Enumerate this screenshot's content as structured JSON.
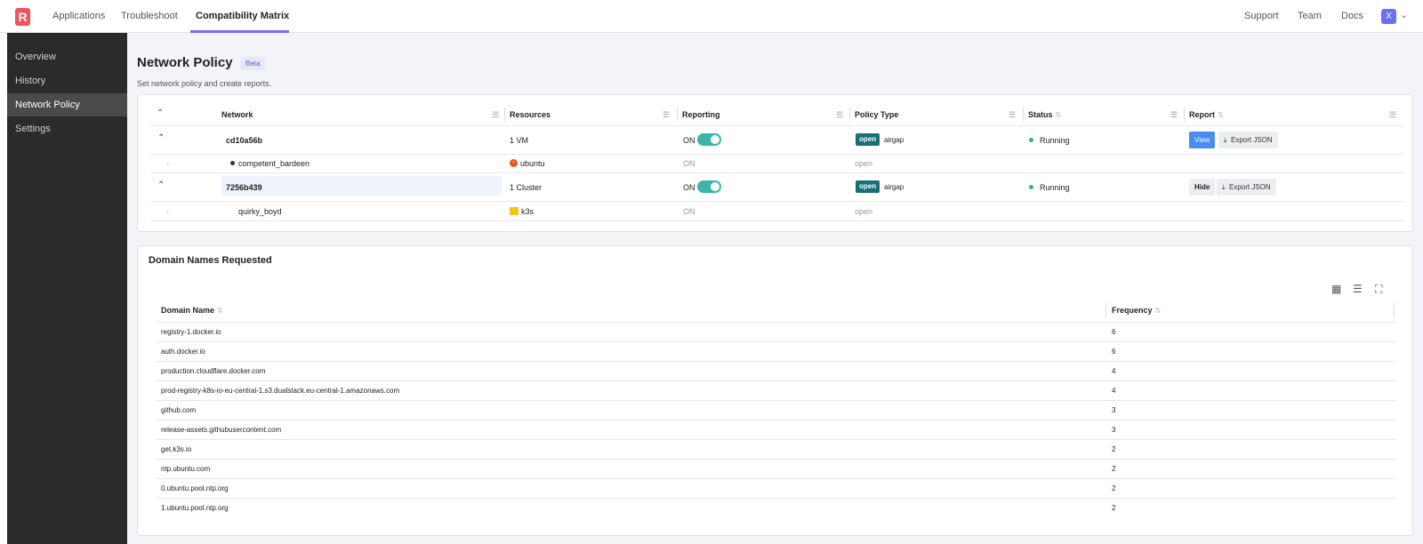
{
  "nav": {
    "logo": "R",
    "tabs": [
      {
        "label": "Applications"
      },
      {
        "label": "Troubleshoot"
      },
      {
        "label": "Compatibility Matrix"
      }
    ],
    "right": [
      {
        "label": "Support"
      },
      {
        "label": "Team"
      },
      {
        "label": "Docs"
      }
    ],
    "avatar": "X"
  },
  "sidebar": {
    "items": [
      {
        "label": "Overview"
      },
      {
        "label": "History"
      },
      {
        "label": "Network Policy"
      },
      {
        "label": "Settings"
      }
    ]
  },
  "page": {
    "title": "Network Policy",
    "badge": "Beta",
    "subtitle": "Set network policy and create reports."
  },
  "networks_table": {
    "columns": [
      "Network",
      "Resources",
      "Reporting",
      "Policy Type",
      "Status",
      "Report"
    ],
    "rows": [
      {
        "network": "cd10a56b",
        "resources": "1 VM",
        "reporting": "ON",
        "policy_badge": "open",
        "policy_type": "airgap",
        "status": "Running",
        "action": "View",
        "export": "Export JSON",
        "child": {
          "name": "competent_bardeen",
          "resource": "ubuntu",
          "reporting": "ON",
          "policy": "open"
        }
      },
      {
        "network": "7256b439",
        "resources": "1 Cluster",
        "reporting": "ON",
        "policy_badge": "open",
        "policy_type": "airgap",
        "status": "Running",
        "action": "Hide",
        "export": "Export JSON",
        "child": {
          "name": "quirky_boyd",
          "resource": "k3s",
          "reporting": "ON",
          "policy": "open"
        }
      }
    ]
  },
  "domains": {
    "title": "Domain Names Requested",
    "columns": [
      "Domain Name",
      "Frequency"
    ],
    "rows": [
      {
        "domain": "registry-1.docker.io",
        "frequency": "6"
      },
      {
        "domain": "auth.docker.io",
        "frequency": "6"
      },
      {
        "domain": "production.cloudflare.docker.com",
        "frequency": "4"
      },
      {
        "domain": "prod-registry-k8s-io-eu-central-1.s3.dualstack.eu-central-1.amazonaws.com",
        "frequency": "4"
      },
      {
        "domain": "github.com",
        "frequency": "3"
      },
      {
        "domain": "release-assets.githubusercontent.com",
        "frequency": "3"
      },
      {
        "domain": "get.k3s.io",
        "frequency": "2"
      },
      {
        "domain": "ntp.ubuntu.com",
        "frequency": "2"
      },
      {
        "domain": "0.ubuntu.pool.ntp.org",
        "frequency": "2"
      },
      {
        "domain": "1.ubuntu.pool.ntp.org",
        "frequency": "2"
      }
    ]
  },
  "colors": {
    "accent": "#6d6ff2",
    "brand": "#f2545b",
    "toggle_on": "#3ab5a7",
    "policy_badge": "#1a6e7a",
    "running": "#3ab57a",
    "view_button": "#4a8df0"
  }
}
